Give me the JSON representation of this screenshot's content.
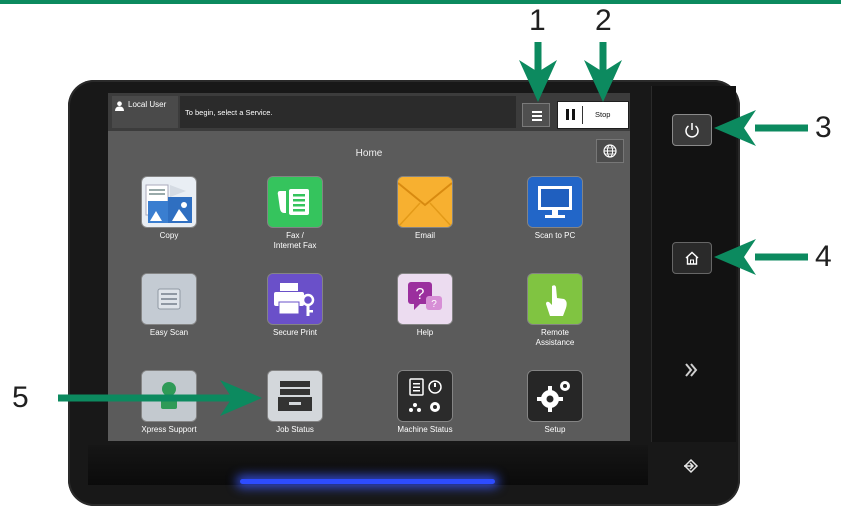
{
  "screen": {
    "user_label": "Local User",
    "prompt_text": "To begin, select a Service.",
    "stop_label": "Stop",
    "home_title": "Home"
  },
  "tiles": [
    {
      "label": "Copy",
      "icon": "copy-icon"
    },
    {
      "label": "Fax /\nInternet Fax",
      "icon": "fax-icon"
    },
    {
      "label": "Email",
      "icon": "email-icon"
    },
    {
      "label": "Scan to PC",
      "icon": "scan-to-pc-icon"
    },
    {
      "label": "Easy Scan",
      "icon": "easy-scan-icon"
    },
    {
      "label": "Secure Print",
      "icon": "secure-print-icon"
    },
    {
      "label": "Help",
      "icon": "help-icon"
    },
    {
      "label": "Remote\nAssistance",
      "icon": "remote-assistance-icon"
    },
    {
      "label": "Xpress Support",
      "icon": "xpress-support-icon"
    },
    {
      "label": "Job Status",
      "icon": "job-status-icon"
    },
    {
      "label": "Machine Status",
      "icon": "machine-status-icon"
    },
    {
      "label": "Setup",
      "icon": "setup-icon"
    }
  ],
  "callouts": [
    "1",
    "2",
    "3",
    "4",
    "5"
  ],
  "colors": {
    "arrow": "#0c8a5f",
    "screen_bg": "#5b5b5b",
    "led": "#2d4cff"
  }
}
